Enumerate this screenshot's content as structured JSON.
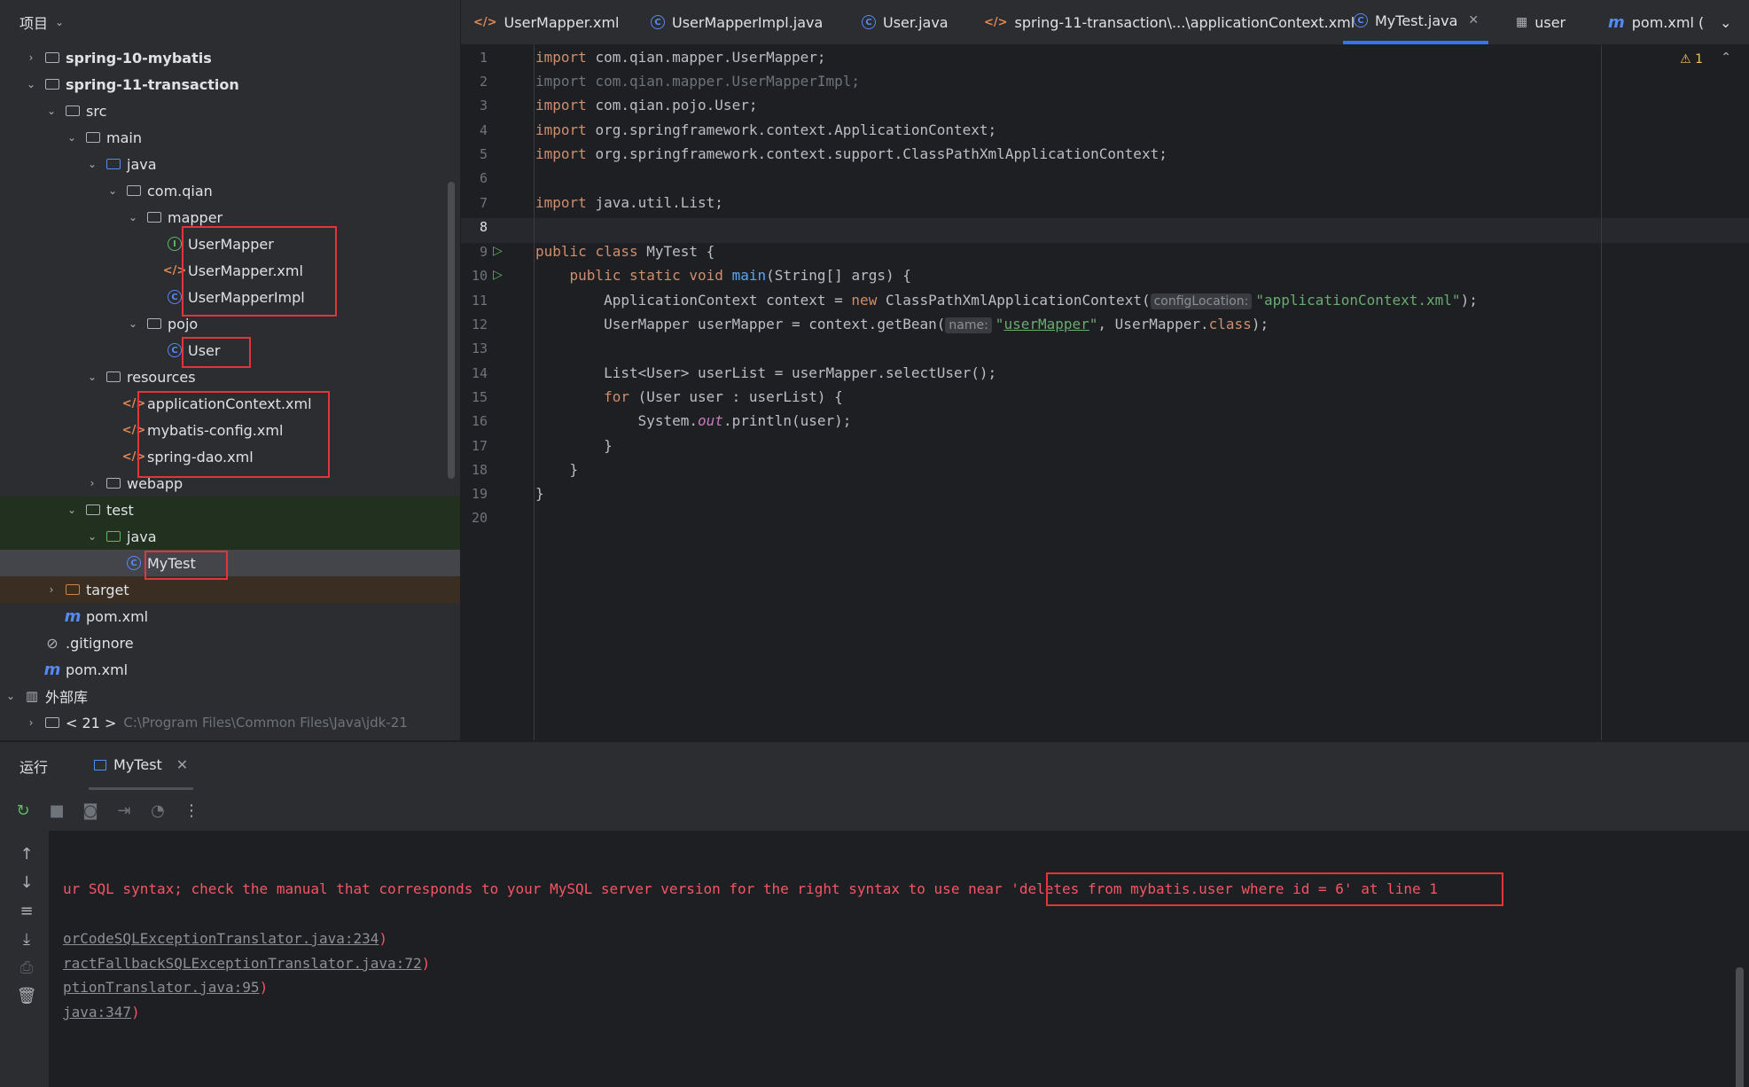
{
  "project": {
    "title": "项目",
    "tree": [
      {
        "label": "spring-10-mybatis",
        "indent": 0,
        "arrow": "›",
        "icon": "module",
        "bold": true
      },
      {
        "label": "spring-11-transaction",
        "indent": 0,
        "arrow": "⌄",
        "icon": "module",
        "bold": true
      },
      {
        "label": "src",
        "indent": 1,
        "arrow": "⌄",
        "icon": "folder"
      },
      {
        "label": "main",
        "indent": 2,
        "arrow": "⌄",
        "icon": "folder"
      },
      {
        "label": "java",
        "indent": 3,
        "arrow": "⌄",
        "icon": "folder-blue"
      },
      {
        "label": "com.qian",
        "indent": 4,
        "arrow": "⌄",
        "icon": "package"
      },
      {
        "label": "mapper",
        "indent": 5,
        "arrow": "⌄",
        "icon": "package"
      },
      {
        "label": "UserMapper",
        "indent": 6,
        "arrow": "",
        "icon": "interface"
      },
      {
        "label": "UserMapper.xml",
        "indent": 6,
        "arrow": "",
        "icon": "xml"
      },
      {
        "label": "UserMapperImpl",
        "indent": 6,
        "arrow": "",
        "icon": "class"
      },
      {
        "label": "pojo",
        "indent": 5,
        "arrow": "⌄",
        "icon": "package"
      },
      {
        "label": "User",
        "indent": 6,
        "arrow": "",
        "icon": "class"
      },
      {
        "label": "resources",
        "indent": 3,
        "arrow": "⌄",
        "icon": "resources"
      },
      {
        "label": "applicationContext.xml",
        "indent": 4,
        "arrow": "",
        "icon": "xml"
      },
      {
        "label": "mybatis-config.xml",
        "indent": 4,
        "arrow": "",
        "icon": "xml"
      },
      {
        "label": "spring-dao.xml",
        "indent": 4,
        "arrow": "",
        "icon": "xml"
      },
      {
        "label": "webapp",
        "indent": 3,
        "arrow": "›",
        "icon": "folder"
      },
      {
        "label": "test",
        "indent": 2,
        "arrow": "⌄",
        "icon": "folder"
      },
      {
        "label": "java",
        "indent": 3,
        "arrow": "⌄",
        "icon": "folder-green"
      },
      {
        "label": "MyTest",
        "indent": 4,
        "arrow": "",
        "icon": "class-test"
      },
      {
        "label": "target",
        "indent": 1,
        "arrow": "›",
        "icon": "folder-orange"
      },
      {
        "label": "pom.xml",
        "indent": 1,
        "arrow": "",
        "icon": "maven"
      },
      {
        "label": ".gitignore",
        "indent": 0,
        "arrow": "",
        "icon": "ignore"
      },
      {
        "label": "pom.xml",
        "indent": 0,
        "arrow": "",
        "icon": "maven"
      },
      {
        "label": "外部库",
        "indent": -1,
        "arrow": "⌄",
        "icon": "library"
      },
      {
        "label": "< 21 >",
        "indent": 0,
        "arrow": "›",
        "icon": "jdk",
        "hint": "C:\\Program Files\\Common Files\\Java\\jdk-21"
      }
    ]
  },
  "tabs": [
    {
      "label": "UserMapper.xml",
      "icon": "xml"
    },
    {
      "label": "UserMapperImpl.java",
      "icon": "class"
    },
    {
      "label": "User.java",
      "icon": "class"
    },
    {
      "label": "spring-11-transaction\\...\\applicationContext.xml",
      "icon": "xml"
    },
    {
      "label": "MyTest.java",
      "icon": "class-test",
      "active": true
    },
    {
      "label": "user",
      "icon": "table"
    },
    {
      "label": "pom.xml (",
      "icon": "maven"
    }
  ],
  "editor": {
    "warning_count": "1",
    "line_numbers": [
      "1",
      "2",
      "3",
      "4",
      "5",
      "6",
      "7",
      "8",
      "9",
      "10",
      "11",
      "12",
      "13",
      "14",
      "15",
      "16",
      "17",
      "18",
      "19",
      "20"
    ],
    "hints": {
      "configLocation": "configLocation:",
      "name": "name:"
    },
    "strings": {
      "app_ctx": "\"applicationContext.xml\"",
      "user_mapper": "userMapper"
    },
    "lines": {
      "l1": "com.qian.mapper.UserMapper;",
      "l2": "import com.qian.mapper.UserMapperImpl;",
      "l3": "com.qian.pojo.User;",
      "l4": "org.springframework.context.ApplicationContext;",
      "l5": "org.springframework.context.support.ClassPathXmlApplicationContext;",
      "l7": "java.util.List;",
      "l9a": "MyTest {",
      "l10a": "main",
      "l10b": "(String[] args) {",
      "l11a": "ApplicationContext context = ",
      "l11b": "ClassPathXmlApplicationContext(",
      "l11c": ");",
      "l12a": "UserMapper userMapper = context.getBean(",
      "l12b": ", UserMapper.",
      "l12c": ");",
      "l14": "List<User> userList = userMapper.selectUser();",
      "l15b": "(User user : userList) {",
      "l16a": "System.",
      "l16b": "out",
      "l16c": ".println(user);",
      "l17": "}",
      "l18": "}",
      "l19": "}"
    },
    "keywords": {
      "import": "import",
      "public": "public",
      "class": "class",
      "static": "static",
      "void": "void",
      "new": "new",
      "for": "for",
      "classkw": "class"
    }
  },
  "run": {
    "label": "运行",
    "tab": "MyTest",
    "console": {
      "error_prefix": "ur SQL syntax; check the manual that corresponds to your MySQL server version for the right syntax to use near ",
      "error_highlight": "'deletes from mybatis.user where id = 6' at line 1",
      "trace": [
        {
          "link": "orCodeSQLExceptionTranslator.java:234",
          "tail": ")"
        },
        {
          "link": "ractFallbackSQLExceptionTranslator.java:72",
          "tail": ")"
        },
        {
          "link": "ptionTranslator.java:95",
          "tail": ")"
        },
        {
          "link": "java:347",
          "tail": ")"
        }
      ]
    }
  }
}
